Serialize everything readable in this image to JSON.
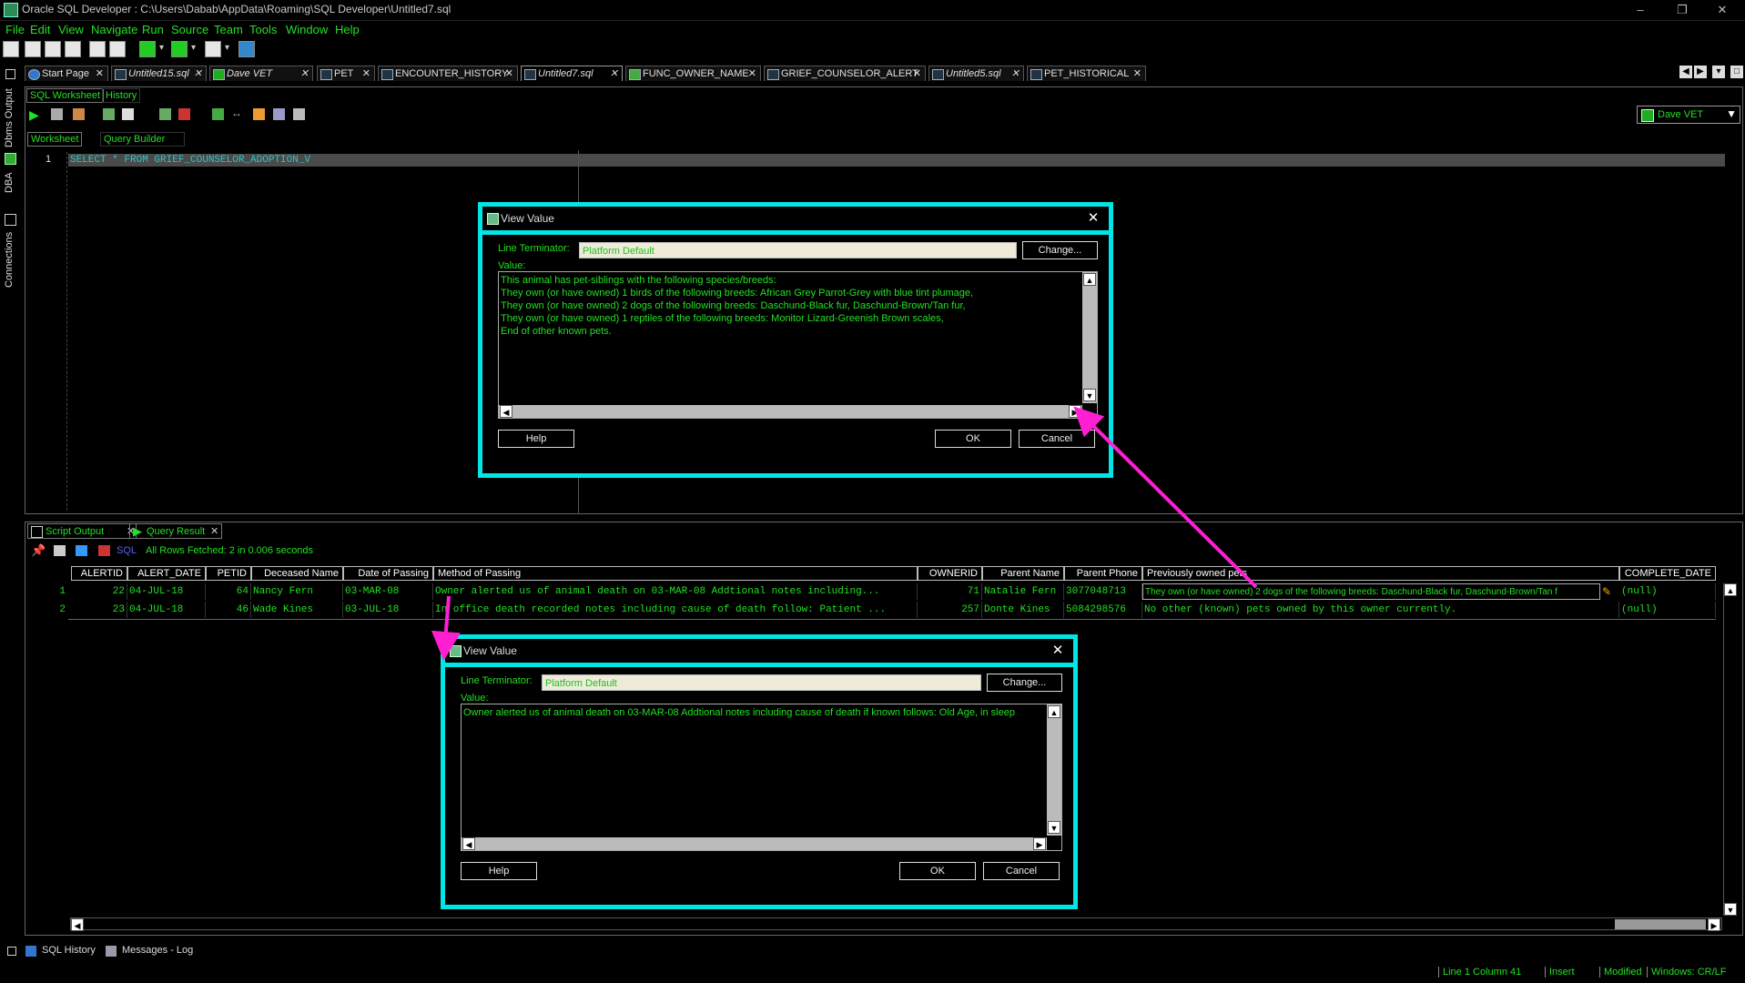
{
  "window": {
    "title": "Oracle SQL Developer : C:\\Users\\Dabab\\AppData\\Roaming\\SQL Developer\\Untitled7.sql",
    "minimize": "–",
    "restore": "❐",
    "close": "✕"
  },
  "menu": [
    "File",
    "Edit",
    "View",
    "Navigate",
    "Run",
    "Source",
    "Team",
    "Tools",
    "Window",
    "Help"
  ],
  "doc_tabs": [
    {
      "label": "Start Page",
      "italic": false
    },
    {
      "label": "Untitled15.sql",
      "italic": true
    },
    {
      "label": "Dave VET",
      "italic": true
    },
    {
      "label": "PET",
      "italic": false
    },
    {
      "label": "ENCOUNTER_HISTORY",
      "italic": false
    },
    {
      "label": "Untitled7.sql",
      "italic": true
    },
    {
      "label": "FUNC_OWNER_NAME",
      "italic": false
    },
    {
      "label": "GRIEF_COUNSELOR_ALERT",
      "italic": false
    },
    {
      "label": "Untitled5.sql",
      "italic": true
    },
    {
      "label": "PET_HISTORICAL",
      "italic": false
    }
  ],
  "left_rail": {
    "dbms_output": "Dbms Output",
    "dba": "DBA",
    "connections": "Connections"
  },
  "worksheet": {
    "tab_sql_worksheet": "SQL Worksheet",
    "tab_history": "History",
    "tab_worksheet": "Worksheet",
    "tab_query_builder": "Query Builder",
    "connection": "Dave VET",
    "line_no": "1",
    "sql": "SELECT * FROM GRIEF_COUNSELOR_ADOPTION_V"
  },
  "results": {
    "tab_script_output": "Script Output",
    "tab_query_result": "Query Result",
    "sql_label": "SQL",
    "fetch_status": "All Rows Fetched: 2 in 0.006 seconds",
    "columns": [
      "ALERTID",
      "ALERT_DATE",
      "PETID",
      "Deceased Name",
      "Date of Passing",
      "Method of Passing",
      "OWNERID",
      "Parent Name",
      "Parent Phone",
      "Previously owned pets",
      "COMPLETE_DATE"
    ],
    "rows": [
      {
        "num": "1",
        "alertid": "22",
        "alert_date": "04-JUL-18",
        "petid": "64",
        "deceased": "Nancy  Fern",
        "date_passing": "03-MAR-08",
        "method": "Owner alerted us of animal death on 03-MAR-08  Addtional notes including...",
        "ownerid": "71",
        "parent": "Natalie Fern",
        "phone": "3077048713",
        "prev_pets": "They own (or have owned) 2 dogs of the following breeds: Daschund-Black fur, Daschund-Brown/Tan f",
        "complete": "(null)"
      },
      {
        "num": "2",
        "alertid": "23",
        "alert_date": "04-JUL-18",
        "petid": "46",
        "deceased": "Wade  Kines",
        "date_passing": "03-JUL-18",
        "method": "In office death recorded notes including cause of death follow: Patient ...",
        "ownerid": "257",
        "parent": "Donte Kines",
        "phone": "5084298576",
        "prev_pets": "No other (known) pets owned by this owner currently.",
        "complete": "(null)"
      }
    ]
  },
  "dialog1": {
    "title": "View Value",
    "line_terminator_label": "Line Terminator:",
    "line_terminator_value": "Platform Default",
    "change_label": "Change...",
    "value_label": "Value:",
    "value_lines": [
      "This animal has pet-siblings with the following species/breeds:",
      "They own (or have owned) 1 birds of the following breeds: African Grey Parrot-Grey with blue tint plumage,",
      "They own (or have owned) 2 dogs of the following breeds: Daschund-Black fur, Daschund-Brown/Tan fur,",
      "They own (or have owned) 1 reptiles of the following breeds: Monitor Lizard-Greenish Brown scales,",
      "End of other known pets."
    ],
    "help_label": "Help",
    "ok_label": "OK",
    "cancel_label": "Cancel"
  },
  "dialog2": {
    "title": "View Value",
    "line_terminator_label": "Line Terminator:",
    "line_terminator_value": "Platform Default",
    "change_label": "Change...",
    "value_label": "Value:",
    "value_lines": [
      "Owner alerted us of animal death on 03-MAR-08  Addtional notes including cause of death if known follows: Old Age, in sleep"
    ],
    "help_label": "Help",
    "ok_label": "OK",
    "cancel_label": "Cancel"
  },
  "bottom": {
    "sql_history": "SQL History",
    "messages_log": "Messages - Log"
  },
  "status": {
    "position": "Line 1 Column 41",
    "mode": "Insert",
    "modified": "Modified",
    "line_endings": "Windows: CR/LF"
  },
  "colors": {
    "accent_cyan": "#00e6e6",
    "text_green": "#22e022",
    "arrow_magenta": "#ff1fd2"
  }
}
